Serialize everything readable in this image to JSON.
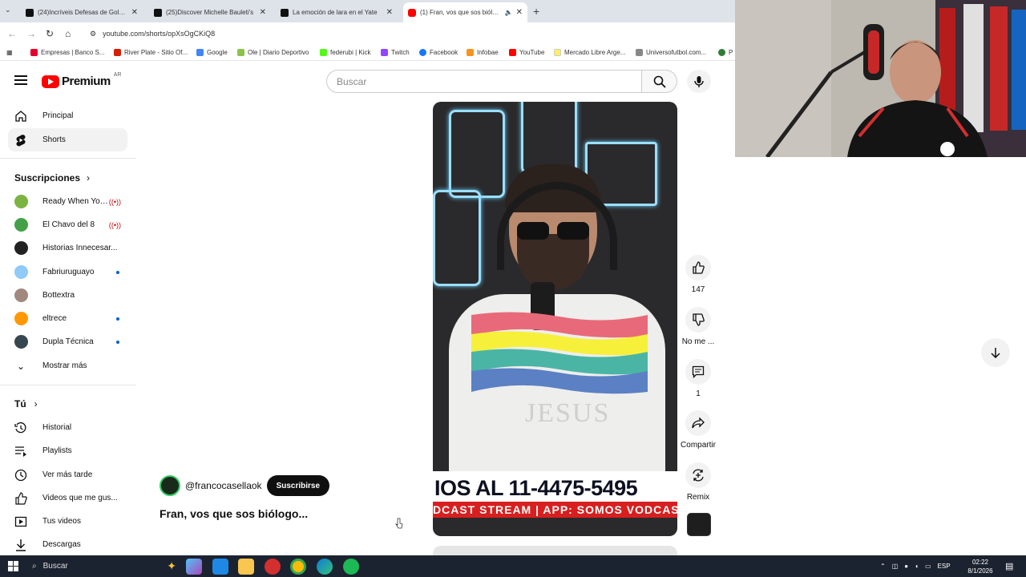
{
  "browser": {
    "tabs": [
      {
        "title": "(24)Incríveis Defesas de Goleiros",
        "icon": "tiktok-icon",
        "active": false
      },
      {
        "title": "(25)Discover Michelle Bauleti's",
        "icon": "tiktok-icon",
        "active": false
      },
      {
        "title": "La emoción de lara en el Yate",
        "icon": "tiktok-icon",
        "active": false
      },
      {
        "title": "(1) Fran, vos que sos biólogo",
        "icon": "youtube-icon",
        "active": true
      }
    ],
    "url": "youtube.com/shorts/opXsOgCKiQ8",
    "bookmarks": [
      {
        "label": "Empresas | Banco S...",
        "color": "#e4002b"
      },
      {
        "label": "River Plate - Sitio Of...",
        "color": "#d81e05"
      },
      {
        "label": "Google",
        "color": "#4285f4"
      },
      {
        "label": "Ole | Diario Deportivo",
        "color": "#8bc34a"
      },
      {
        "label": "federubi | Kick",
        "color": "#53fc18"
      },
      {
        "label": "Twitch",
        "color": "#9146ff"
      },
      {
        "label": "Facebook",
        "color": "#1877f2"
      },
      {
        "label": "Infobae",
        "color": "#f7941d"
      },
      {
        "label": "YouTube",
        "color": "#ff0000"
      },
      {
        "label": "Mercado Libre Arge...",
        "color": "#fff159"
      },
      {
        "label": "Universofutbol.com...",
        "color": "#888888"
      },
      {
        "label": "P",
        "color": "#2e7d32"
      }
    ]
  },
  "youtube": {
    "logo": "Premium",
    "country": "AR",
    "search_placeholder": "Buscar",
    "sidebar": {
      "main": [
        {
          "label": "Principal",
          "icon": "home-icon"
        },
        {
          "label": "Shorts",
          "icon": "shorts-icon",
          "selected": true
        }
      ],
      "subs_title": "Suscripciones",
      "subs": [
        {
          "label": "Ready When You'...",
          "color": "#7cb342",
          "live": true
        },
        {
          "label": "El Chavo del 8",
          "color": "#43a047",
          "live": true
        },
        {
          "label": "Historias Innecesar...",
          "color": "#222222"
        },
        {
          "label": "Fabriuruguayo",
          "color": "#90caf9",
          "dot": true
        },
        {
          "label": "Bottextra",
          "color": "#a1887f"
        },
        {
          "label": "eltrece",
          "color": "#ff9800",
          "dot": true
        },
        {
          "label": "Dupla Técnica",
          "color": "#37474f",
          "dot": true
        }
      ],
      "show_more": "Mostrar más",
      "you_title": "Tú",
      "you": [
        {
          "label": "Historial",
          "icon": "history-icon"
        },
        {
          "label": "Playlists",
          "icon": "playlists-icon"
        },
        {
          "label": "Ver más tarde",
          "icon": "clock-icon"
        },
        {
          "label": "Videos que me gus...",
          "icon": "thumbs-up-icon"
        },
        {
          "label": "Tus videos",
          "icon": "video-icon"
        },
        {
          "label": "Descargas",
          "icon": "download-icon"
        }
      ]
    },
    "short": {
      "overlay_phone": "IOS AL 11-4475-5495",
      "overlay_strip": "DCAST STREAM | APP: SOMOS VODCAST |",
      "shirt_text": "JESUS",
      "channel": "@francocasellaok",
      "subscribe": "Suscribirse",
      "title": "Fran, vos que sos biólogo...",
      "actions": {
        "likes": "147",
        "dislike": "No me ...",
        "comments": "1",
        "share": "Compartir",
        "remix": "Remix"
      }
    }
  },
  "taskbar": {
    "search": "Buscar",
    "lang": "ESP",
    "time": "02:22",
    "date": "8/1/2026"
  }
}
